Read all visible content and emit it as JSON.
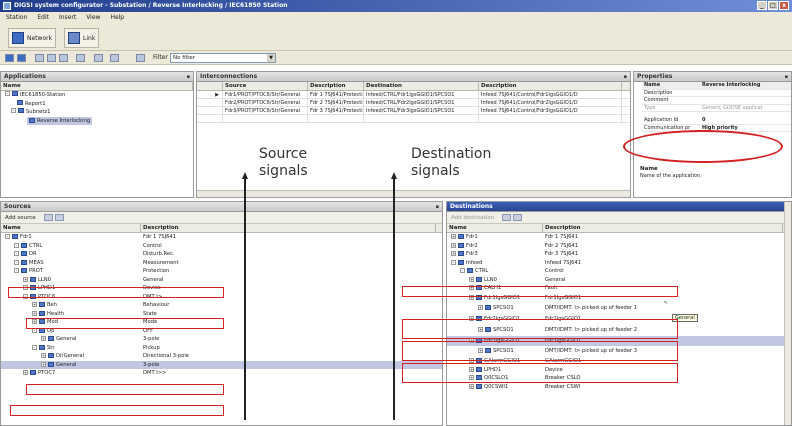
{
  "window": {
    "title": "DIGSI system configurator - Substation / Reverse Interlocking / IEC61850 Station"
  },
  "menu": [
    "Station",
    "Edit",
    "Insert",
    "View",
    "Help"
  ],
  "toolbar": {
    "network_label": "Network",
    "link_label": "Link",
    "filter_label": "Filter",
    "filter_value": "No filter"
  },
  "applications": {
    "header": "Applications",
    "col_name": "Name",
    "tree": [
      "IEC61850-Station",
      "Report1",
      "Subnetz1",
      "Reverse Interlocking"
    ]
  },
  "interconnections": {
    "header": "Interconnections",
    "columns": [
      "Source",
      "Description",
      "Destination",
      "Description"
    ],
    "rows": [
      [
        "Fdr1/PROT/PTOC6/Str/General",
        "Fdr 1 7SJ641/Protecti...",
        "Infeed/CTRL/Fdr1IgsGGIO1/SPCSO1",
        "Infeed 7SJ641/Control/Fdr1IgsGGIO1/D"
      ],
      [
        "Fdr2/PROT/PTOC6/Str/General",
        "Fdr 2 7SJ641/Protecti...",
        "Infeed/CTRL/Fdr2IgsGGIO1/SPCSO1",
        "Infeed 7SJ641/Control/Fdr2IgsGGIO1/D"
      ],
      [
        "Fdr3/PROT/PTOC6/Str/General",
        "Fdr 3 7SJ641/Protecti...",
        "Infeed/CTRL/Fdr3IgsGGIO1/SPCSO1",
        "Infeed 7SJ641/Control/Fdr3IgsGGIO1/D"
      ]
    ]
  },
  "properties": {
    "header": "Properties",
    "rows": [
      [
        "Name",
        "Reverse Interlocking"
      ],
      [
        "Description",
        ""
      ],
      [
        "Comment",
        ""
      ],
      [
        "Type",
        "Generic GOOSE applicat"
      ],
      [
        "Application Id",
        "0"
      ],
      [
        "Communication pr",
        "High priority"
      ]
    ],
    "name_title": "Name",
    "name_desc": "Name of the application."
  },
  "source": {
    "header": "Sources",
    "add_label": "Add source",
    "col_name": "Name",
    "col_desc": "Description",
    "rows": [
      [
        "Fdr1",
        "Fdr 1 7SJ641"
      ],
      [
        "CTRL",
        "Control"
      ],
      [
        "DR",
        "Disturb.Rec."
      ],
      [
        "MEAS",
        "Measurement"
      ],
      [
        "PROT",
        "Protection"
      ],
      [
        "LLN0",
        "General"
      ],
      [
        "LPHD1",
        "Device"
      ],
      [
        "PTOC6",
        "DMT I>"
      ],
      [
        "Beh",
        "Behaviour"
      ],
      [
        "Health",
        "State"
      ],
      [
        "Mod",
        "Mode"
      ],
      [
        "Op",
        "OFF"
      ],
      [
        "General",
        "3-pole"
      ],
      [
        "Str",
        "Pickup"
      ],
      [
        "DirGeneral",
        "Directional 3-pole"
      ],
      [
        "General",
        "3-pole"
      ],
      [
        "PTOC7",
        "DMT I>>"
      ]
    ]
  },
  "destination": {
    "header": "Destinations",
    "add_label": "Add destination",
    "col_name": "Name",
    "col_desc": "Description",
    "rows": [
      [
        "Fdr1",
        "Fdr 1 7SJ641"
      ],
      [
        "Fdr2",
        "Fdr 2 7SJ641"
      ],
      [
        "Fdr3",
        "Fdr 3 7SJ641"
      ],
      [
        "Infeed",
        "Infeed 7SJ641"
      ],
      [
        "CTRL",
        "Control"
      ],
      [
        "LLN0",
        "General"
      ],
      [
        "CALH1",
        "Fault"
      ],
      [
        "Fdr1IgsGGIO1",
        "Fdr1IgsGGIO1"
      ],
      [
        "SPCSO1",
        "DMT/IDMT: I> picked up of feeder 1"
      ],
      [
        "Fdr2IgsGGIO1",
        "Fdr2IgsGGIO1"
      ],
      [
        "SPCSO1",
        "DMT/IDMT: I> picked up of feeder 2"
      ],
      [
        "Fdr3IgsGGIO1",
        "Fdr3IgsGGIO1"
      ],
      [
        "SPCSO1",
        "DMT/IDMT: I> picked up of feeder 3"
      ],
      [
        "GAlarmGGIO1",
        "GAlarmGGIO1"
      ],
      [
        "LPHD1",
        "Device"
      ],
      [
        "Q0CSLO1",
        "Breaker CSLO"
      ],
      [
        "Q0CSWI1",
        "Breaker CSWI"
      ]
    ],
    "tooltip": "General"
  },
  "annotations": {
    "source_line1": "Source",
    "source_line2": "signals",
    "dest_line1": "Destination",
    "dest_line2": "signals"
  }
}
